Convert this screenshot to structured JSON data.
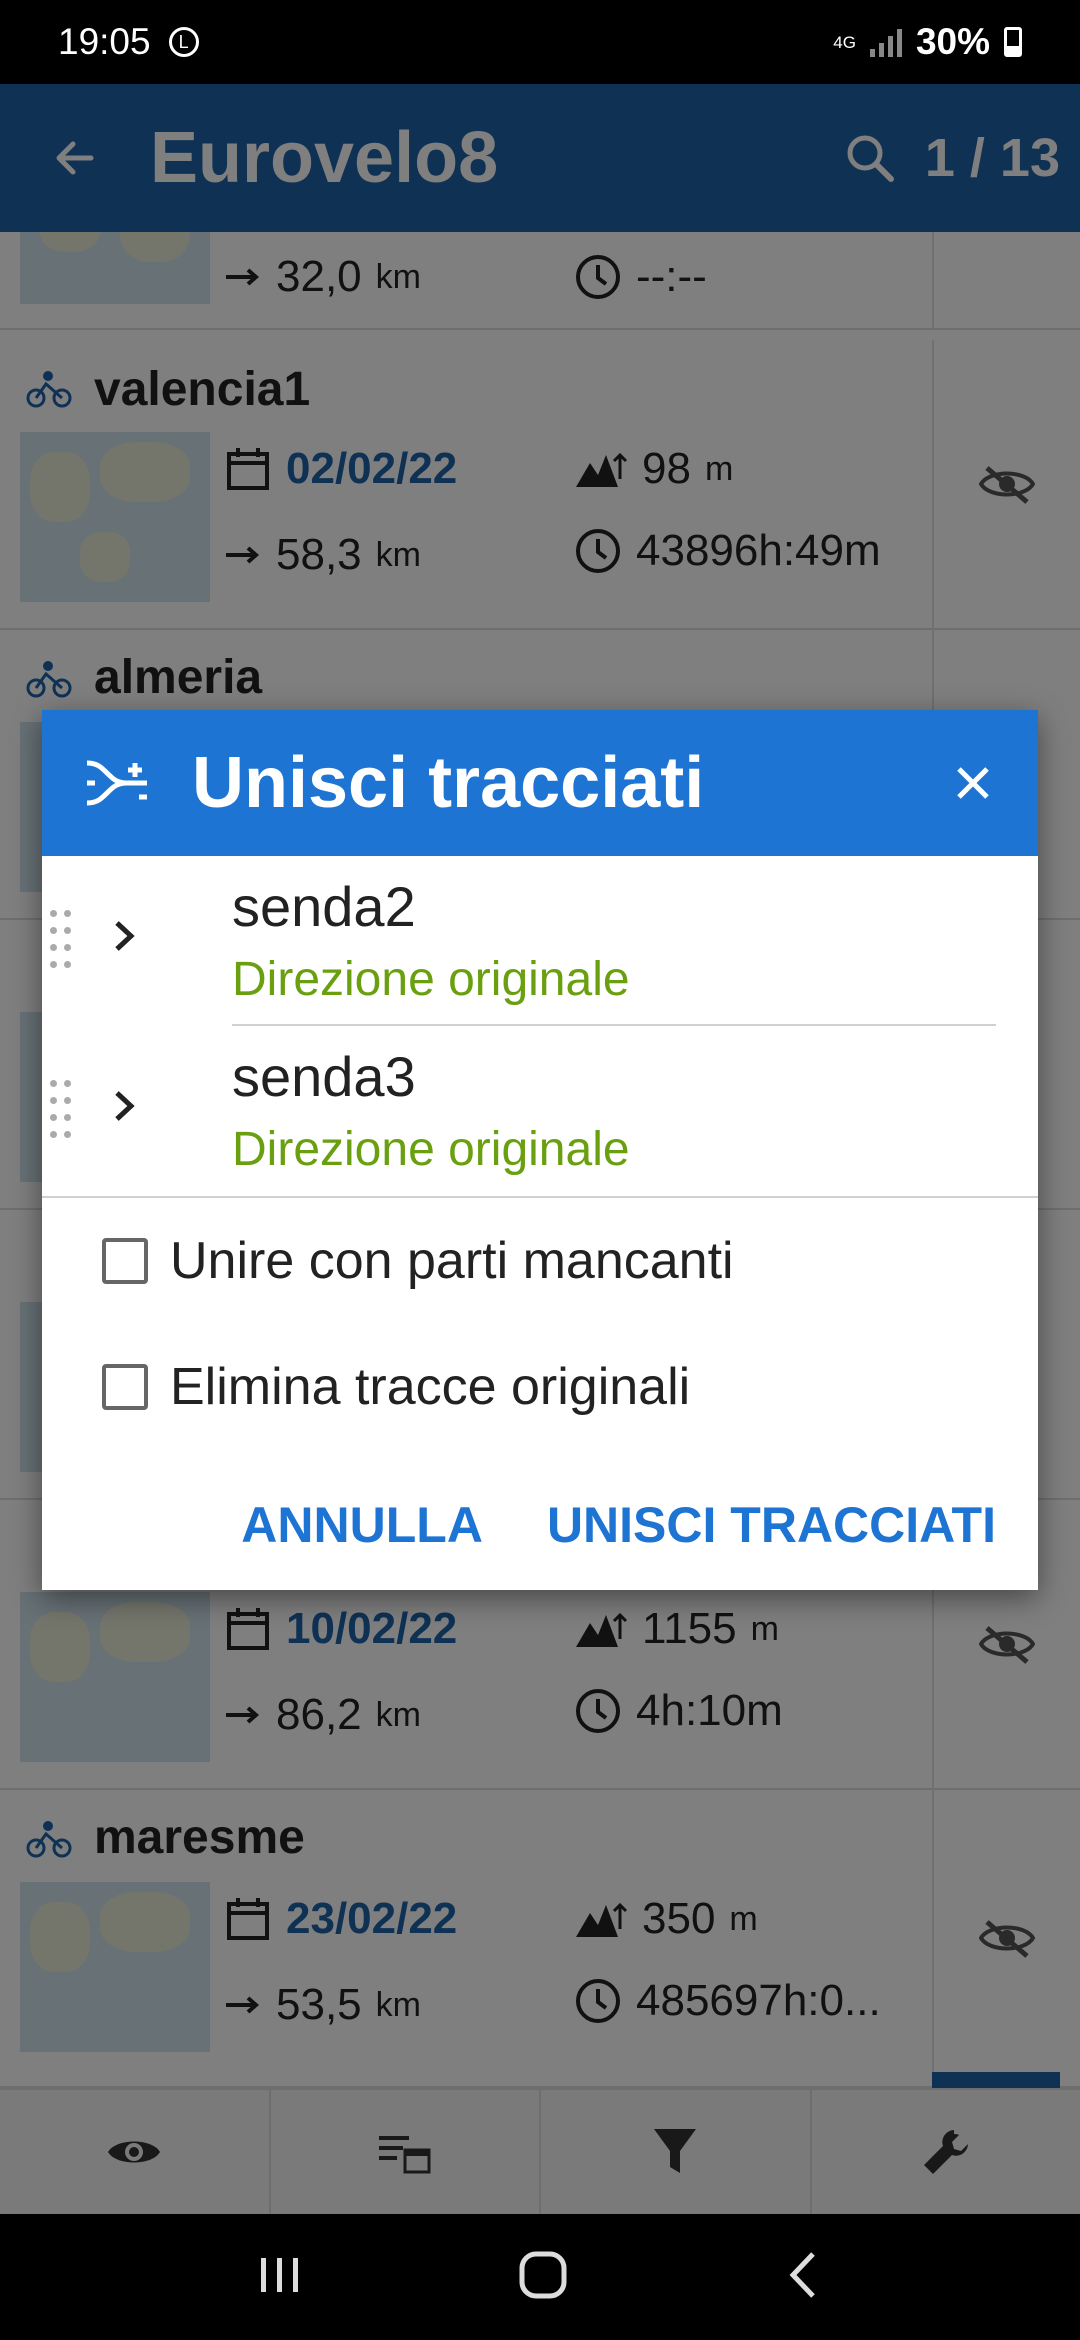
{
  "status_bar": {
    "time": "19:05",
    "clock_badge": "L",
    "network": "4G",
    "battery": "30%"
  },
  "app_bar": {
    "title": "Eurovelo8",
    "counter": "1 / 13"
  },
  "list": {
    "top_partial": {
      "distance": "32,0",
      "distance_unit": "km",
      "duration": "--:--"
    },
    "items": [
      {
        "name": "valencia1",
        "date": "02/02/22",
        "elevation": "98",
        "elevation_unit": "m",
        "distance": "58,3",
        "distance_unit": "km",
        "duration": "43896h:49m"
      },
      {
        "name": "almeria"
      },
      {
        "name": "",
        "date": "10/02/22",
        "elevation": "1155",
        "elevation_unit": "m",
        "distance": "86,2",
        "distance_unit": "km",
        "duration": "4h:10m"
      },
      {
        "name": "maresme",
        "date": "23/02/22",
        "elevation": "350",
        "elevation_unit": "m",
        "distance": "53,5",
        "distance_unit": "km",
        "duration": "485697h:0..."
      }
    ]
  },
  "dialog": {
    "title": "Unisci tracciati",
    "tracks": [
      {
        "name": "senda2",
        "direction": "Direzione originale"
      },
      {
        "name": "senda3",
        "direction": "Direzione originale"
      }
    ],
    "options": [
      {
        "label": "Unire con parti mancanti",
        "checked": false
      },
      {
        "label": "Elimina tracce originali",
        "checked": false
      }
    ],
    "cancel_label": "ANNULLA",
    "confirm_label": "UNISCI TRACCIATI"
  },
  "bottom_bar": {
    "icons": [
      "eye-icon",
      "list-calendar-icon",
      "filter-icon",
      "wrench-icon"
    ]
  },
  "nav_bar": {
    "icons": [
      "recents-icon",
      "home-icon",
      "back-icon"
    ]
  },
  "colors": {
    "primary": "#1e63a8",
    "dialog_header": "#1e74d3",
    "direction_green": "#6aa00f",
    "date_blue": "#1e63a8"
  }
}
